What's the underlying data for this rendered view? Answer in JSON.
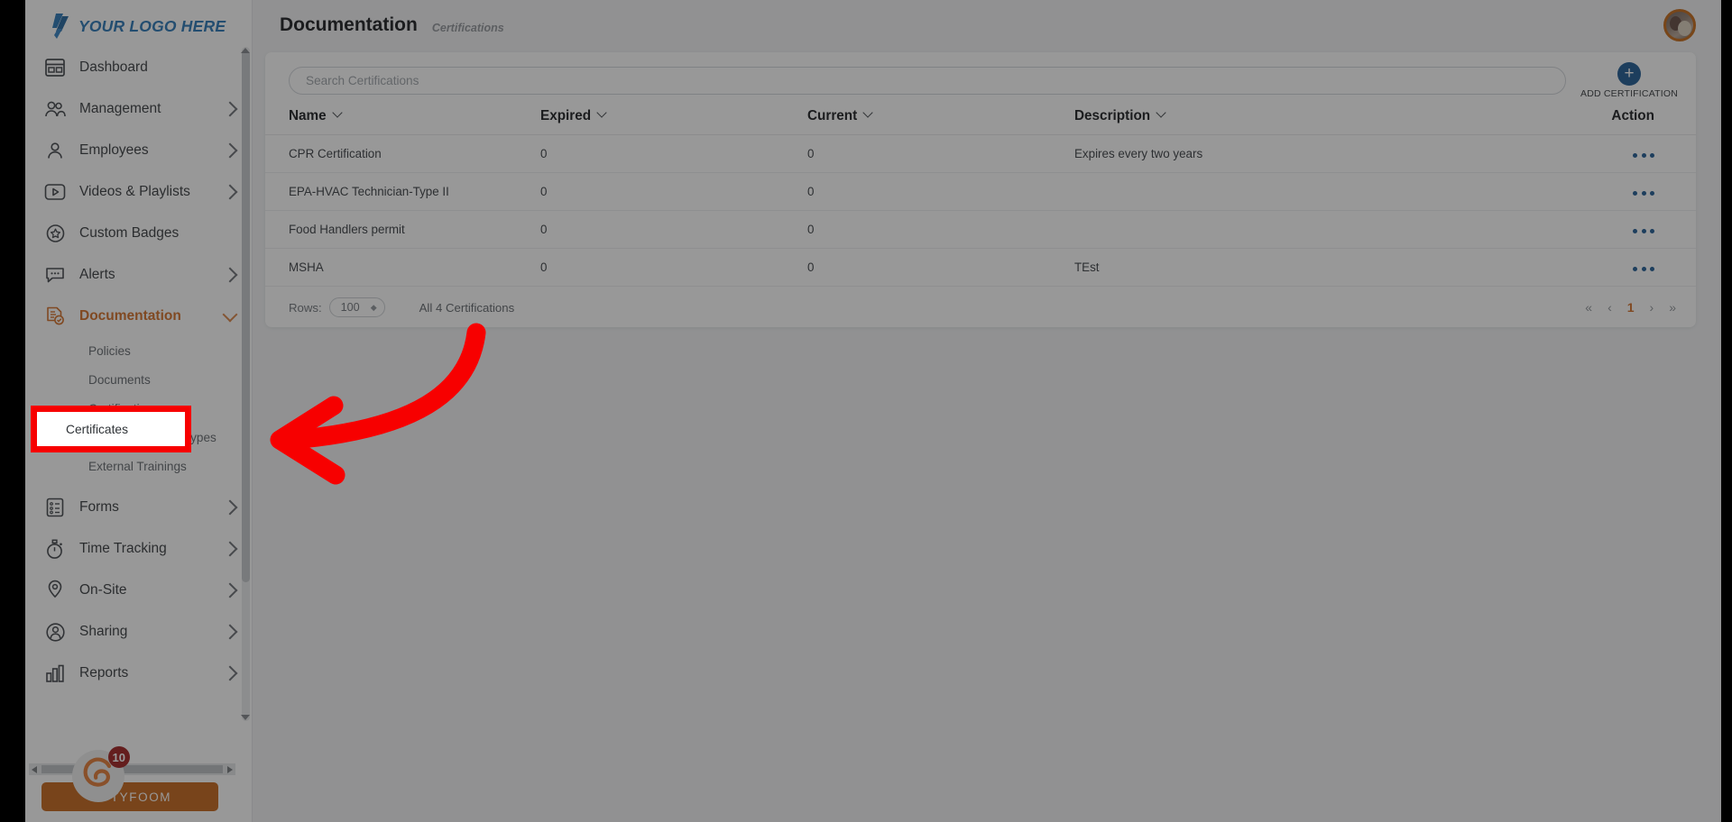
{
  "brand": {
    "logo_text": "YOUR LOGO HERE",
    "logo_color": "#1f6fb2",
    "footer_button_label": "TYFOOM",
    "footer_badge_count": "10",
    "footer_button_color": "#c25e10"
  },
  "sidebar": {
    "items": [
      {
        "label": "Dashboard",
        "icon": "dashboard-icon",
        "has_chevron": false,
        "active": false
      },
      {
        "label": "Management",
        "icon": "people-icon",
        "has_chevron": true,
        "active": false
      },
      {
        "label": "Employees",
        "icon": "person-icon",
        "has_chevron": true,
        "active": false
      },
      {
        "label": "Videos & Playlists",
        "icon": "video-play-icon",
        "has_chevron": true,
        "active": false
      },
      {
        "label": "Custom Badges",
        "icon": "badge-star-icon",
        "has_chevron": false,
        "active": false
      },
      {
        "label": "Alerts",
        "icon": "chat-alert-icon",
        "has_chevron": true,
        "active": false
      },
      {
        "label": "Documentation",
        "icon": "document-check-icon",
        "has_chevron": true,
        "active": true
      }
    ],
    "documentation_subitems": [
      {
        "label": "Policies"
      },
      {
        "label": "Documents"
      },
      {
        "label": "Certifications"
      },
      {
        "label": "External Training Types"
      },
      {
        "label": "External Trainings"
      }
    ],
    "items_after": [
      {
        "label": "Forms",
        "icon": "form-list-icon",
        "has_chevron": true
      },
      {
        "label": "Time Tracking",
        "icon": "stopwatch-icon",
        "has_chevron": true
      },
      {
        "label": "On-Site",
        "icon": "map-pin-icon",
        "has_chevron": true
      },
      {
        "label": "Sharing",
        "icon": "share-person-icon",
        "has_chevron": true
      },
      {
        "label": "Reports",
        "icon": "bar-chart-icon",
        "has_chevron": true
      }
    ]
  },
  "header": {
    "title": "Documentation",
    "subtitle": "Certifications"
  },
  "toolbar": {
    "search_placeholder": "Search Certifications",
    "search_value": "",
    "add_button_label": "ADD CERTIFICATION",
    "add_button_icon": "plus-icon",
    "add_button_color": "#14538f"
  },
  "table": {
    "columns": [
      {
        "label": "Name",
        "sortable": true
      },
      {
        "label": "Expired",
        "sortable": true
      },
      {
        "label": "Current",
        "sortable": true
      },
      {
        "label": "Description",
        "sortable": true
      },
      {
        "label": "Action",
        "sortable": false
      }
    ],
    "rows": [
      {
        "name": "CPR Certification",
        "expired": "0",
        "current": "0",
        "description": "Expires every two years"
      },
      {
        "name": "EPA-HVAC Technician-Type II",
        "expired": "0",
        "current": "0",
        "description": ""
      },
      {
        "name": "Food Handlers permit",
        "expired": "0",
        "current": "0",
        "description": ""
      },
      {
        "name": "MSHA",
        "expired": "0",
        "current": "0",
        "description": "TEst"
      }
    ]
  },
  "footer": {
    "rows_label": "Rows:",
    "rows_value": "100",
    "total_label": "All 4 Certifications",
    "pager": {
      "first": "«",
      "prev": "‹",
      "current": "1",
      "next": "›",
      "last": "»",
      "current_color": "#d2691e"
    }
  },
  "callout": {
    "highlight_label": "Certificates",
    "highlight_color": "#f70000",
    "arrow_color": "#f70000"
  }
}
